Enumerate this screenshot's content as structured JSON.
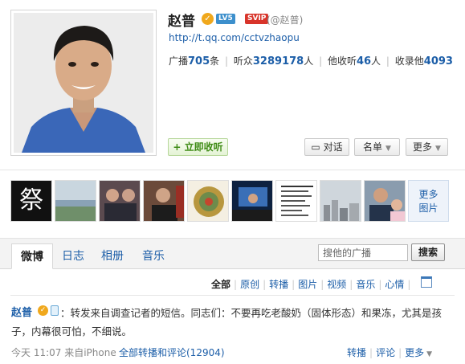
{
  "profile": {
    "name": "赵普",
    "verified_mark": "✓",
    "level_badge": "LV5",
    "svip_badge": "SVIP",
    "handle": "(@赵普)",
    "url": "http://t.qq.com/cctvzhaopu",
    "stats": {
      "broadcast_label": "广播",
      "broadcast_count": "705",
      "broadcast_unit": "条",
      "listeners_label": "听众",
      "listeners_count": "3289178",
      "listeners_unit": "人",
      "he_listens_label": "他收听",
      "he_listens_count": "46",
      "he_listens_unit": "人",
      "collected_label": "收录他",
      "collected_count": "4093"
    },
    "actions": {
      "listen": "+ 立即收听",
      "dialog": "对话",
      "list": "名单",
      "more": "更多"
    }
  },
  "photos": {
    "more_line1": "更多",
    "more_line2": "图片",
    "thumb1_glyph": "祭"
  },
  "tabs": {
    "weibo": "微博",
    "diary": "日志",
    "album": "相册",
    "music": "音乐"
  },
  "search": {
    "placeholder": "搜他的广播",
    "button": "搜索"
  },
  "filters": {
    "all": "全部",
    "original": "原创",
    "repost": "转播",
    "image": "图片",
    "video": "视频",
    "music": "音乐",
    "mood": "心情"
  },
  "post": {
    "author": "赵普",
    "verified_mark": "✓",
    "text": "：转发来自调查记者的短信。同志们：不要再吃老酸奶（固体形态）和果冻，尤其是孩子，内幕很可怕，不细说。",
    "meta": "今天 11:07 来自iPhone",
    "thread_link": "全部转播和评论(12904)",
    "actions": {
      "repost": "转播",
      "comment": "评论",
      "more": "更多"
    }
  },
  "colors": {
    "link": "#1c5ea8",
    "verified": "#f0a81c",
    "listen_green": "#3d8a14"
  }
}
